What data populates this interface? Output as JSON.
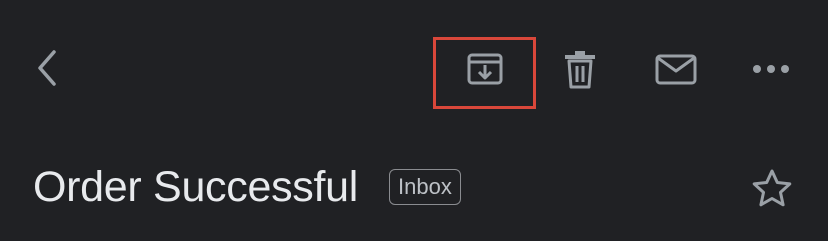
{
  "toolbar": {
    "back_icon": "chevron-left-icon",
    "archive_icon": "archive-icon",
    "delete_icon": "trash-icon",
    "mark_unread_icon": "envelope-icon",
    "more_icon": "more-horizontal-icon",
    "highlight_color": "#d9473a"
  },
  "message": {
    "subject": "Order Successful",
    "label": "Inbox",
    "star_icon": "star-outline-icon"
  },
  "colors": {
    "background": "#202124",
    "text": "#e8eaed",
    "icon": "#9aa0a6"
  }
}
